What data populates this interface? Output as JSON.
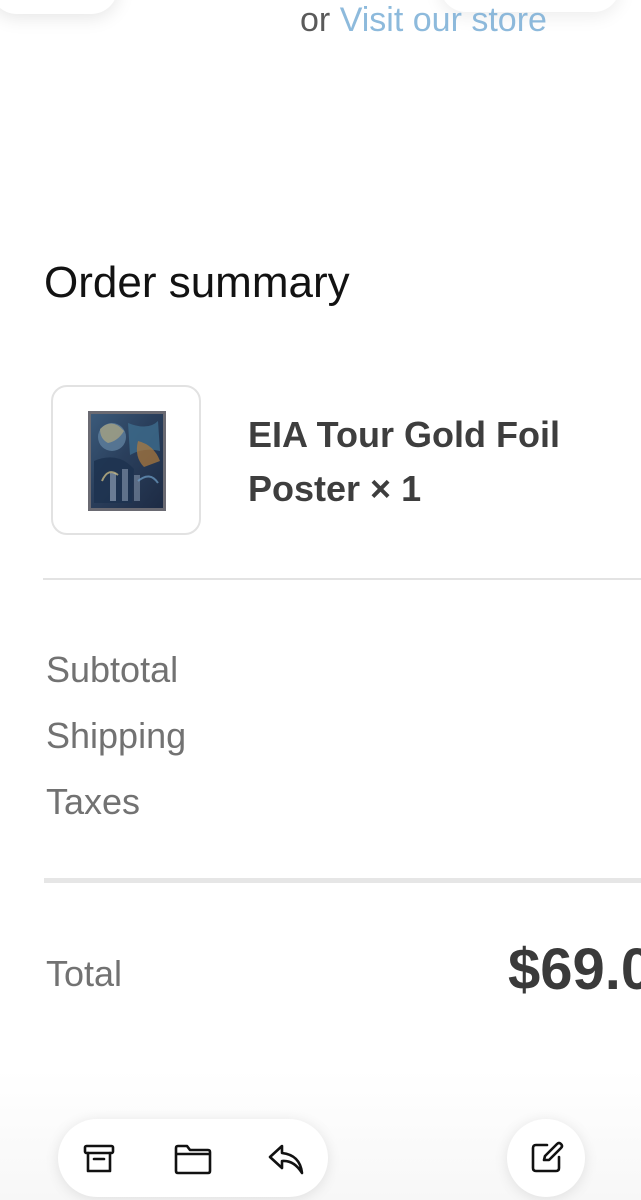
{
  "header": {
    "or_text": "or",
    "visit_store_link": "Visit our store"
  },
  "order_summary": {
    "title": "Order summary",
    "item": {
      "name": "EIA Tour Gold Foil Poster × 1",
      "thumbnail": "poster-artwork"
    },
    "labels": {
      "subtotal": "Subtotal",
      "shipping": "Shipping",
      "taxes": "Taxes"
    },
    "total": {
      "label": "Total",
      "amount": "$69.0"
    }
  },
  "toolbar": {
    "icons": [
      "archive-icon",
      "folder-icon",
      "reply-icon"
    ],
    "compose_icon": "compose-icon"
  },
  "colors": {
    "link": "#7aaed6",
    "title": "#121212",
    "secondary_text": "#727272",
    "divider": "#e3e3e3"
  }
}
